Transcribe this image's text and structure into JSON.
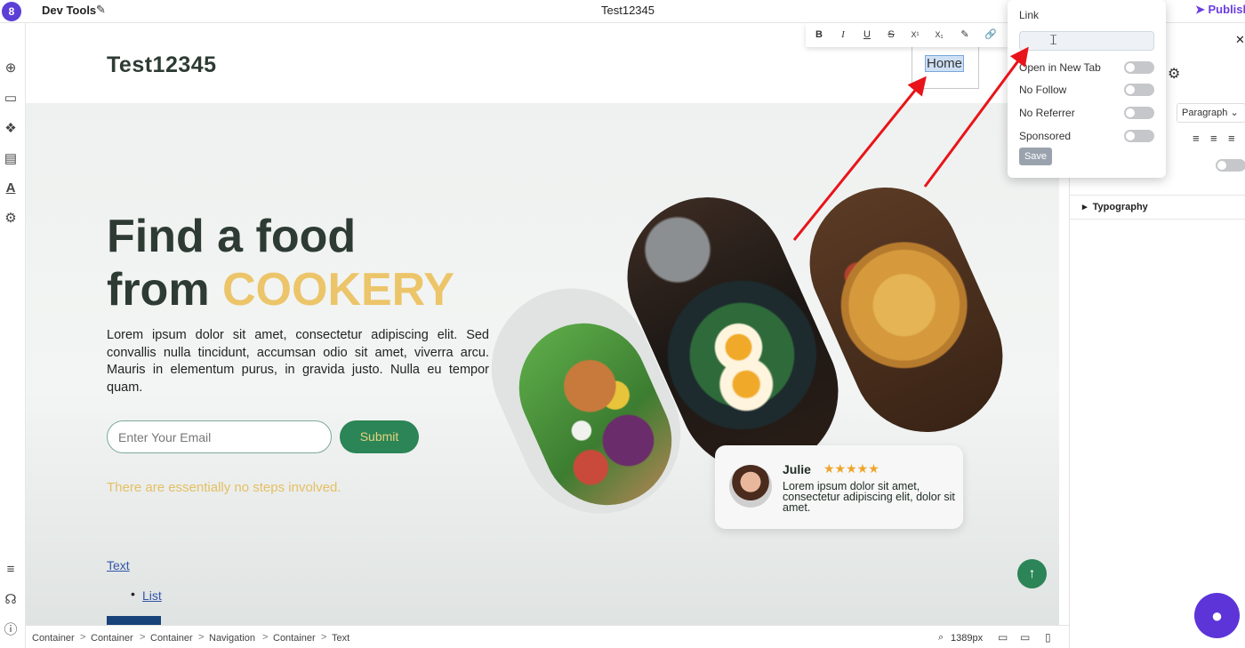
{
  "topbar": {
    "app_title": "Dev Tools",
    "doc_title": "Test12345",
    "publish_label": "Publish"
  },
  "icons": {
    "app_logo": "8",
    "edit": "✎",
    "add": "⊕",
    "section": "▭",
    "components": "❖",
    "pages": "▤",
    "typography": "A",
    "settings": "⚙",
    "layers": "≡",
    "support": "☊",
    "info": "ⓘ",
    "close": "✕",
    "gear": "⚙",
    "scroll_up": "↑",
    "chat": "●",
    "zoom": "🔍"
  },
  "toolbar": {
    "bold": "B",
    "italic": "I",
    "underline": "U",
    "strike": "S",
    "superscript": "X¹",
    "subscript": "X₁",
    "highlight": "✎",
    "link": "🔗"
  },
  "site": {
    "logo": "Test12345",
    "nav_home": "Home",
    "heading_line1": "Find a food",
    "heading_line2_prefix": "from ",
    "heading_accent": "COOKERY",
    "paragraph": "Lorem ipsum dolor sit amet, consectetur adipiscing elit. Sed convallis nulla tincidunt, accumsan odio sit amet, viverra arcu. Mauris in elementum purus, in gravida justo. Nulla eu tempor quam.",
    "email_placeholder": "Enter Your Email",
    "submit_label": "Submit",
    "tagline": "There are essentially no steps involved.",
    "text_link": "Text",
    "list_item": "List",
    "review": {
      "name": "Julie",
      "stars": "★★★★★",
      "rating": 5,
      "text": "Lorem ipsum dolor sit amet, consectetur adipiscing elit, dolor sit amet."
    }
  },
  "link_popup": {
    "title": "Link",
    "url_value": "",
    "options": [
      "Open in New Tab",
      "No Follow",
      "No Referrer",
      "Sponsored"
    ],
    "save_label": "Save"
  },
  "right_panel": {
    "select_value": "Paragraph",
    "align_left": "≡",
    "align_center": "≡",
    "align_right": "≡",
    "typography_label": "Typography",
    "expand_icon": "▸"
  },
  "bottombar": {
    "breadcrumbs": [
      "Container",
      "Container",
      "Container",
      "Navigation",
      "Container",
      "Text"
    ],
    "separator": ">",
    "zoom": "1389px",
    "desktop_icon": "▭",
    "tablet_icon": "▭",
    "mobile_icon": "▯"
  },
  "colors": {
    "brand": "#5d34d8",
    "accent": "#ecc56a",
    "primary_green": "#2b8556",
    "heading": "#2e3b34",
    "annotation_arrow": "#e8141a"
  }
}
